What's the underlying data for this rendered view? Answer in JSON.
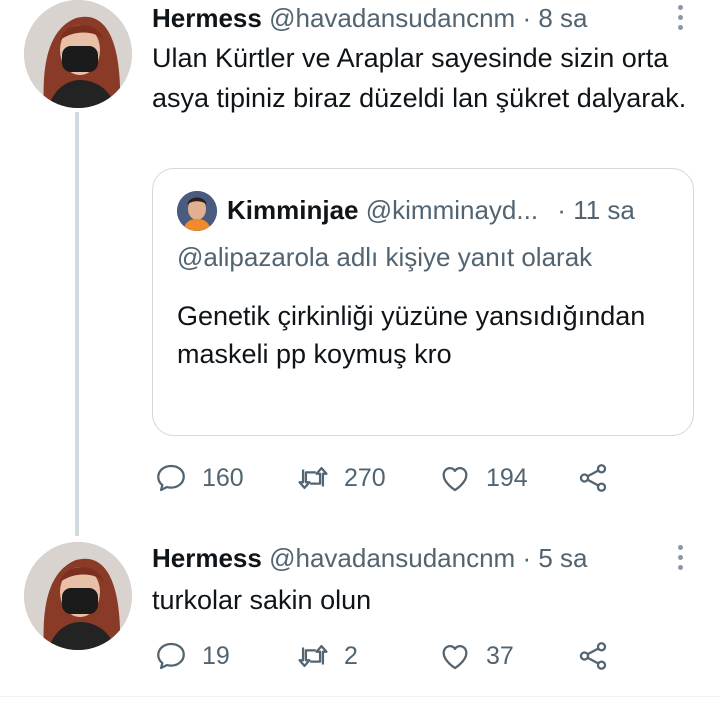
{
  "tweets": [
    {
      "name": "Hermess",
      "handle": "@havadansudancnm",
      "dot": "·",
      "time": "8 sa",
      "text": "Ulan Kürtler ve Araplar sayesinde sizin orta asya tipiniz biraz düzeldi lan şükret dalyarak.",
      "quote": {
        "name": "Kimminjae",
        "handle": "@kimminayd...",
        "dot": "·",
        "time": "11 sa",
        "reply_to": "@alipazarola adlı kişiye yanıt olarak",
        "text": "Genetik çirkinliği yüzüne yansıdığından maskeli pp koymuş kro"
      },
      "actions": {
        "reply": "160",
        "retweet": "270",
        "like": "194"
      }
    },
    {
      "name": "Hermess",
      "handle": "@havadansudancnm",
      "dot": "·",
      "time": "5 sa",
      "text": "turkolar sakin olun",
      "actions": {
        "reply": "19",
        "retweet": "2",
        "like": "37"
      }
    }
  ],
  "icons": [
    "more-icon",
    "reply-icon",
    "retweet-icon",
    "like-icon",
    "share-icon"
  ],
  "colors": {
    "text": "#0f1419",
    "secondary": "#536471",
    "border": "#cfd9de",
    "thread_line": "#cfd9de"
  }
}
